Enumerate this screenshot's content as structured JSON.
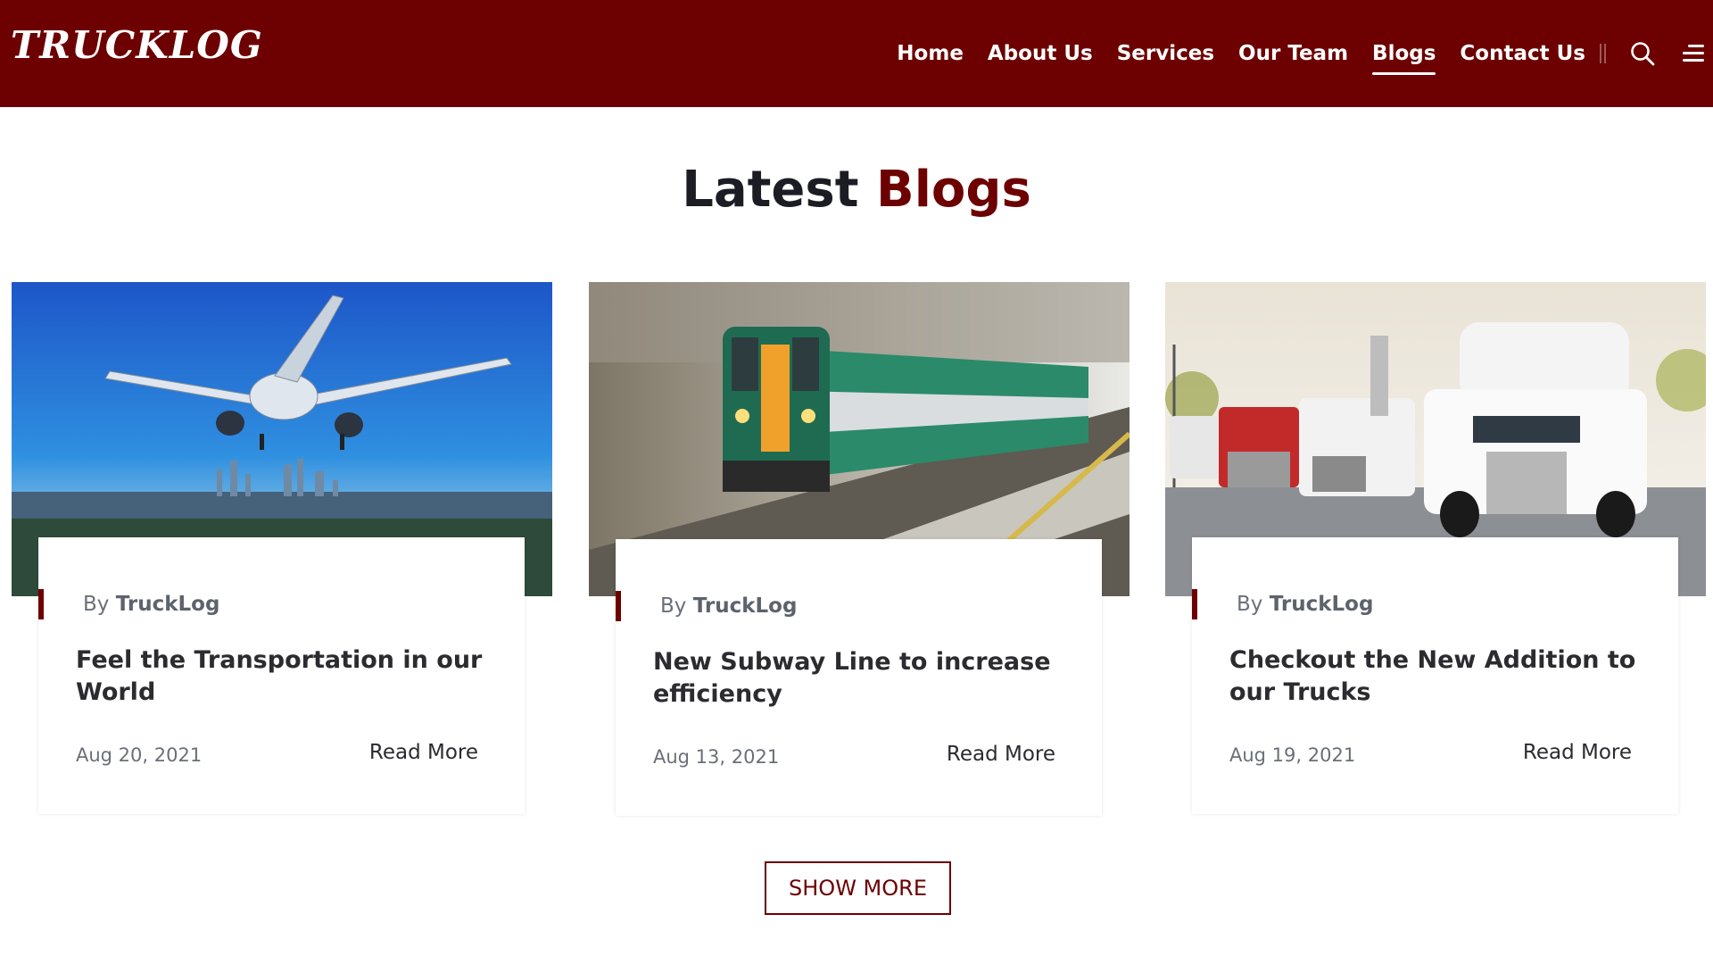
{
  "header": {
    "logo": "TRUCKLOG",
    "nav": [
      {
        "label": "Home",
        "active": false
      },
      {
        "label": "About Us",
        "active": false
      },
      {
        "label": "Services",
        "active": false
      },
      {
        "label": "Our Team",
        "active": false
      },
      {
        "label": "Blogs",
        "active": true
      },
      {
        "label": "Contact Us",
        "active": false
      }
    ],
    "icons": [
      "search-icon",
      "menu-icon"
    ]
  },
  "section": {
    "title_plain": "Latest",
    "title_accent": "Blogs"
  },
  "posts": [
    {
      "image": "airplane-over-city-image",
      "author_prefix": "By",
      "author": "TruckLog",
      "title": "Feel the Transportation in our World",
      "date": "Aug 20, 2021",
      "read_more": "Read More"
    },
    {
      "image": "speeding-train-image",
      "author_prefix": "By",
      "author": "TruckLog",
      "title": "New Subway Line to increase efficiency",
      "date": "Aug 13, 2021",
      "read_more": "Read More"
    },
    {
      "image": "trucks-parked-image",
      "author_prefix": "By",
      "author": "TruckLog",
      "title": "Checkout the New Addition to our Trucks",
      "date": "Aug 19, 2021",
      "read_more": "Read More"
    }
  ],
  "show_more": "SHOW MORE",
  "colors": {
    "brand": "#6d0000",
    "text_dark": "#1c1c24",
    "text_muted": "#6a6f78"
  }
}
